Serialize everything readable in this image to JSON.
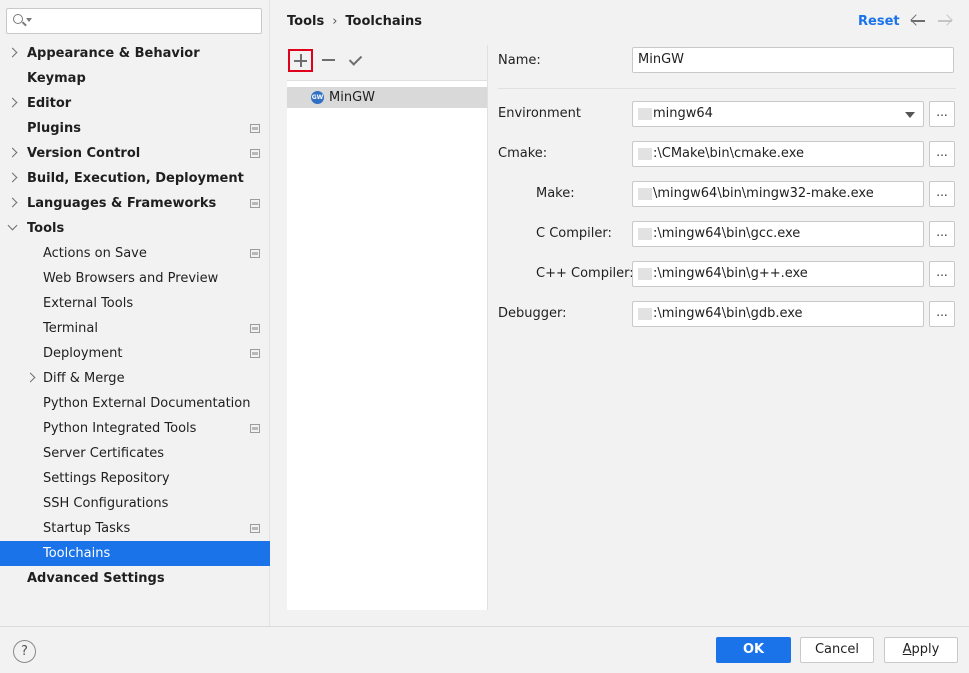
{
  "search": {
    "value": "",
    "placeholder": ""
  },
  "sidebar": {
    "items": [
      {
        "label": "Appearance & Behavior",
        "level": 0,
        "bold": true,
        "chevron": "right",
        "project": false
      },
      {
        "label": "Keymap",
        "level": 0,
        "bold": true,
        "chevron": "none",
        "project": false
      },
      {
        "label": "Editor",
        "level": 0,
        "bold": true,
        "chevron": "right",
        "project": false
      },
      {
        "label": "Plugins",
        "level": 0,
        "bold": true,
        "chevron": "none",
        "project": true
      },
      {
        "label": "Version Control",
        "level": 0,
        "bold": true,
        "chevron": "right",
        "project": true
      },
      {
        "label": "Build, Execution, Deployment",
        "level": 0,
        "bold": true,
        "chevron": "right",
        "project": false
      },
      {
        "label": "Languages & Frameworks",
        "level": 0,
        "bold": true,
        "chevron": "right",
        "project": true
      },
      {
        "label": "Tools",
        "level": 0,
        "bold": true,
        "chevron": "down",
        "project": false
      },
      {
        "label": "Actions on Save",
        "level": 1,
        "bold": false,
        "chevron": "none",
        "project": true
      },
      {
        "label": "Web Browsers and Preview",
        "level": 1,
        "bold": false,
        "chevron": "none",
        "project": false
      },
      {
        "label": "External Tools",
        "level": 1,
        "bold": false,
        "chevron": "none",
        "project": false
      },
      {
        "label": "Terminal",
        "level": 1,
        "bold": false,
        "chevron": "none",
        "project": true
      },
      {
        "label": "Deployment",
        "level": 1,
        "bold": false,
        "chevron": "none",
        "project": true
      },
      {
        "label": "Diff & Merge",
        "level": 1,
        "bold": false,
        "chevron": "right",
        "project": false
      },
      {
        "label": "Python External Documentation",
        "level": 1,
        "bold": false,
        "chevron": "none",
        "project": false
      },
      {
        "label": "Python Integrated Tools",
        "level": 1,
        "bold": false,
        "chevron": "none",
        "project": true
      },
      {
        "label": "Server Certificates",
        "level": 1,
        "bold": false,
        "chevron": "none",
        "project": false
      },
      {
        "label": "Settings Repository",
        "level": 1,
        "bold": false,
        "chevron": "none",
        "project": false
      },
      {
        "label": "SSH Configurations",
        "level": 1,
        "bold": false,
        "chevron": "none",
        "project": false
      },
      {
        "label": "Startup Tasks",
        "level": 1,
        "bold": false,
        "chevron": "none",
        "project": true
      },
      {
        "label": "Toolchains",
        "level": 1,
        "bold": false,
        "chevron": "none",
        "project": false,
        "selected": true
      },
      {
        "label": "Advanced Settings",
        "level": 0,
        "bold": true,
        "chevron": "none",
        "project": false
      }
    ]
  },
  "header": {
    "breadcrumb": [
      "Tools",
      "Toolchains"
    ],
    "breadcrumb_separator": "›",
    "reset_label": "Reset"
  },
  "toolchains": {
    "items": [
      {
        "label": "MinGW",
        "icon": "gcc-wrench-icon",
        "icon_text": "GW"
      }
    ]
  },
  "form": {
    "name_label": "Name:",
    "name_value": "MinGW",
    "environment_label": "Environment",
    "environment_value": "mingw64",
    "cmake_label": "Cmake:",
    "cmake_value": ":\\CMake\\bin\\cmake.exe",
    "make_label": "Make:",
    "make_value": "\\mingw64\\bin\\mingw32-make.exe",
    "c_compiler_label": "C Compiler:",
    "c_compiler_value": ":\\mingw64\\bin\\gcc.exe",
    "cpp_compiler_label": "C++ Compiler:",
    "cpp_compiler_value": ":\\mingw64\\bin\\g++.exe",
    "debugger_label": "Debugger:",
    "debugger_value": ":\\mingw64\\bin\\gdb.exe",
    "browse_label": "..."
  },
  "footer": {
    "help_label": "?",
    "ok_label": "OK",
    "cancel_label": "Cancel",
    "apply_first": "A",
    "apply_rest": "pply"
  },
  "colors": {
    "accent": "#1a73e8",
    "highlight_box": "#e0001b",
    "selected_list_bg": "#d9d9d9"
  }
}
